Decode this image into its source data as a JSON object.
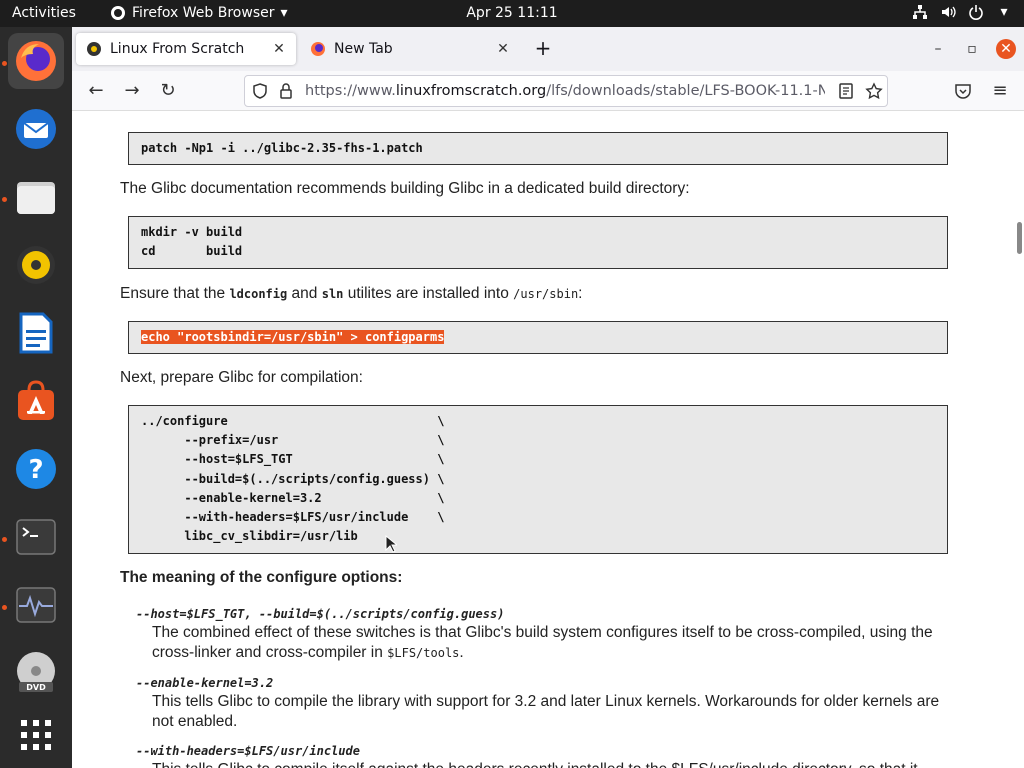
{
  "topbar": {
    "activities": "Activities",
    "app_name": "Firefox Web Browser",
    "clock": "Apr 25  11:11"
  },
  "dock": {
    "items": [
      "firefox-icon",
      "thunderbird-icon",
      "files-icon",
      "rhythmbox-icon",
      "writer-icon",
      "software-icon",
      "help-icon",
      "terminal-icon",
      "system-monitor-icon",
      "dvd-icon",
      "apps-grid-icon"
    ]
  },
  "browser": {
    "tabs": [
      {
        "title": "Linux From Scratch"
      },
      {
        "title": "New Tab"
      }
    ],
    "url_prefix": "https://www.",
    "url_domain": "linuxfromscratch.org",
    "url_path": "/lfs/downloads/stable/LFS-BOOK-11.1-N"
  },
  "page": {
    "code1": "patch -Np1 -i ../glibc-2.35-fhs-1.patch",
    "para1": "The Glibc documentation recommends building Glibc in a dedicated build directory:",
    "code2": "mkdir -v build\ncd       build",
    "para2_a": "Ensure that the ",
    "para2_code1": "ldconfig",
    "para2_b": " and ",
    "para2_code2": "sln",
    "para2_c": " utilites are installed into ",
    "para2_code3": "/usr/sbin",
    "para2_d": ":",
    "code3": "echo \"rootsbindir=/usr/sbin\" > configparms",
    "para3": "Next, prepare Glibc for compilation:",
    "code4": "../configure                             \\\n      --prefix=/usr                      \\\n      --host=$LFS_TGT                    \\\n      --build=$(../scripts/config.guess) \\\n      --enable-kernel=3.2                \\\n      --with-headers=$LFS/usr/include    \\\n      libc_cv_slibdir=/usr/lib",
    "heading": "The meaning of the configure options:",
    "dt1": "--host=$LFS_TGT, --build=$(../scripts/config.guess)",
    "dd1_a": "The combined effect of these switches is that Glibc's build system configures itself to be cross-compiled, using the cross-linker and cross-compiler in ",
    "dd1_code": "$LFS/tools",
    "dd1_b": ".",
    "dt2": "--enable-kernel=3.2",
    "dd2": "This tells Glibc to compile the library with support for 3.2 and later Linux kernels. Workarounds for older kernels are not enabled.",
    "dt3": "--with-headers=$LFS/usr/include",
    "dd3": "This tells Glibc to compile itself against the headers recently installed to the $LFS/usr/include directory, so that it"
  }
}
